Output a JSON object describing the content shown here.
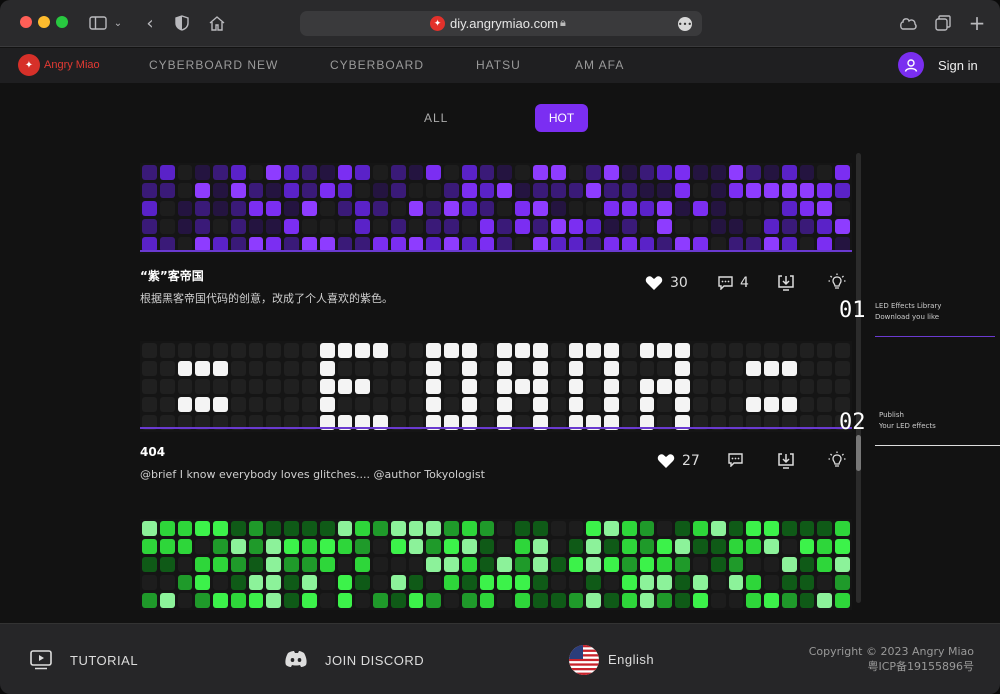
{
  "browser": {
    "url": "diy.angrymiao.com",
    "traffic_lights": [
      "#ff5f57",
      "#febc2e",
      "#28c840"
    ]
  },
  "site": {
    "logo_text": "Angry Miao",
    "nav": [
      "CYBERBOARD NEW",
      "CYBERBOARD",
      "HATSU",
      "AM AFA"
    ],
    "sign_in": "Sign in",
    "accent": "#7b2ef2"
  },
  "filters": {
    "all": "ALL",
    "hot": "HOT"
  },
  "effects": [
    {
      "title": "“紫”客帝国",
      "description": "根据黑客帝国代码的创意，改成了个人喜欢的紫色。",
      "likes": "30",
      "comments": "4"
    },
    {
      "title": "404",
      "description": "@brief I know everybody loves glitches.... @author Tokyologist",
      "likes": "27",
      "comments": ""
    }
  ],
  "steps": [
    {
      "num": "01",
      "line1": "LED Effects Library",
      "line2": "Download you like"
    },
    {
      "num": "02",
      "line1": "Publish",
      "line2": "Your LED effects"
    }
  ],
  "footer": {
    "tutorial": "TUTORIAL",
    "discord": "JOIN DISCORD",
    "language": "English",
    "copyright": "Copyright © 2023 Angry Miao",
    "icp": "粤ICP备19155896号"
  }
}
